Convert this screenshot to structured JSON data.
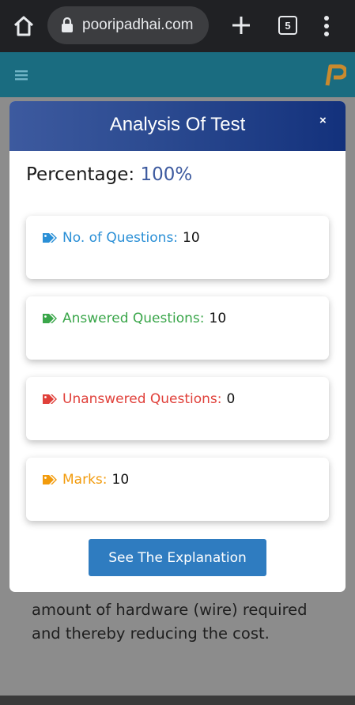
{
  "browser": {
    "url": "pooripadhai.com",
    "tab_count": "5",
    "icons": [
      "home-icon",
      "lock-icon",
      "new-tab-icon",
      "tabs-icon",
      "menu-icon"
    ]
  },
  "site_header": {
    "bg_color": "#1a6c80",
    "logo_letter": "P",
    "icons": [
      "hamburger-icon",
      "site-logo"
    ]
  },
  "modal": {
    "title": "Analysis Of Test",
    "close": "×",
    "percentage_label": "Percentage:",
    "percentage_value": "100%",
    "stats": [
      {
        "label": "No. of Questions:",
        "value": "10",
        "color": "#2a8fd6",
        "icon": "tag-icon"
      },
      {
        "label": "Answered Questions:",
        "value": "10",
        "color": "#3aa64a",
        "icon": "tag-icon"
      },
      {
        "label": "Unanswered Questions:",
        "value": "0",
        "color": "#e0403a",
        "icon": "tag-icon"
      },
      {
        "label": "Marks:",
        "value": "10",
        "color": "#f29b0c",
        "icon": "tag-icon"
      }
    ],
    "button_label": "See The Explanation"
  },
  "background_text": {
    "line1": "amount of hardware (wire) required",
    "line2": "and thereby reducing the cost."
  }
}
